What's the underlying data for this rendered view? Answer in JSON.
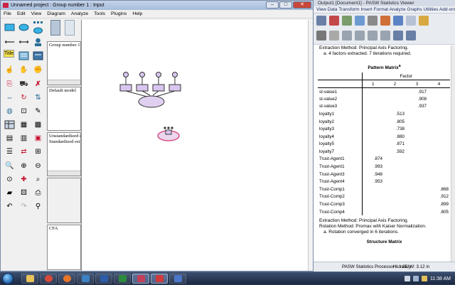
{
  "amos": {
    "title": "Unnamed project : Group number 1 : Input",
    "menu": [
      "File",
      "Edit",
      "View",
      "Diagram",
      "Analyze",
      "Tools",
      "Plugins",
      "Help"
    ],
    "groups_pane": "Group number 1",
    "models_pane": "Default model",
    "estimates_pane": [
      "Unstandardized estimates",
      "Standardized estimates"
    ],
    "file_pane": "CFA",
    "title_tool_label": "Title"
  },
  "spss": {
    "title": "Output1 [Document1] - PASW Statistics Viewer",
    "menu": "View Data Transform Insert Format Analyze Graphs Utilities Add-ons Window Help",
    "top_notes": [
      "Extraction Method: Principal Axis Factoring.",
      "a. 4 factors extracted. 7 iterations required."
    ],
    "pattern_title": "Pattern Matrix",
    "pattern_title_sup": "a",
    "factor_header": "Factor",
    "columns": [
      "1",
      "2",
      "3",
      "4"
    ],
    "rows": [
      {
        "label": "st-value1",
        "values": [
          "",
          "",
          ".917",
          ""
        ]
      },
      {
        "label": "st-value2",
        "values": [
          "",
          "",
          ".908",
          ""
        ]
      },
      {
        "label": "st-value3",
        "values": [
          "",
          "",
          ".937",
          ""
        ]
      },
      {
        "label": "loyalty1",
        "values": [
          "",
          ".513",
          "",
          ""
        ]
      },
      {
        "label": "loyalty2",
        "values": [
          "",
          ".805",
          "",
          ""
        ]
      },
      {
        "label": "loyalty3",
        "values": [
          "",
          ".738",
          "",
          ""
        ]
      },
      {
        "label": "loyalty4",
        "values": [
          "",
          ".880",
          "",
          ""
        ]
      },
      {
        "label": "loyalty5",
        "values": [
          "",
          ".871",
          "",
          ""
        ]
      },
      {
        "label": "loyalty7",
        "values": [
          "",
          ".592",
          "",
          ""
        ]
      },
      {
        "label": "Trust-Agent1",
        "values": [
          ".874",
          "",
          "",
          ""
        ]
      },
      {
        "label": "Trust-Agent1",
        "values": [
          ".993",
          "",
          "",
          ""
        ]
      },
      {
        "label": "Trust-Agent3",
        "values": [
          ".948",
          "",
          "",
          ""
        ]
      },
      {
        "label": "Trust-Agent4",
        "values": [
          ".953",
          "",
          "",
          ""
        ]
      },
      {
        "label": "Trust-Comp1",
        "values": [
          "",
          "",
          "",
          ".868"
        ]
      },
      {
        "label": "Trust-Comp2",
        "values": [
          "",
          "",
          "",
          ".912"
        ]
      },
      {
        "label": "Trust-Comp3",
        "values": [
          "",
          "",
          "",
          ".899"
        ]
      },
      {
        "label": "Trust-Comp4",
        "values": [
          "",
          "",
          "",
          ".805"
        ]
      }
    ],
    "bottom_notes": [
      "Extraction Method: Principal Axis Factoring.",
      "Rotation Method: Promax with Kaiser Normalization.",
      "a. Rotation converged in 6 iterations."
    ],
    "cut_text": "Structure Matrix",
    "status_processor": "PASW Statistics Processor is ready",
    "status_position": "H: 1.25, W: 3.12 in"
  },
  "taskbar": {
    "clock": "11:38 AM",
    "apps": [
      "windows-explorer",
      "chrome",
      "firefox",
      "media-player",
      "word",
      "excel",
      "amos",
      "pasw",
      "outlook"
    ]
  },
  "colors": {
    "observed_fill": "#d9c6f0",
    "latent_fill": "#e0d0f0",
    "selected_outline": "#d6366f",
    "taskbar": "#1c2942"
  }
}
